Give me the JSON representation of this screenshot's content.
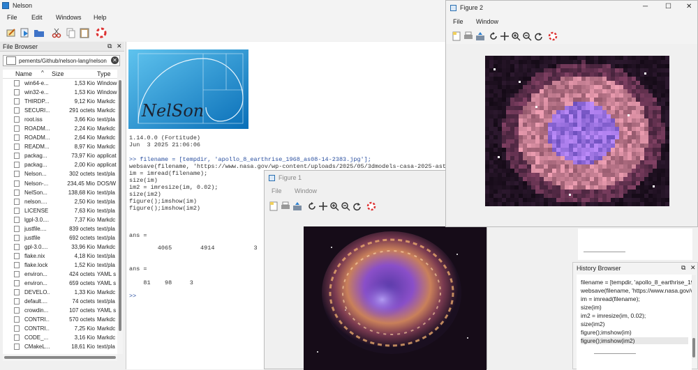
{
  "app": {
    "title": "Nelson"
  },
  "menus": [
    "File",
    "Edit",
    "Windows",
    "Help"
  ],
  "file_browser": {
    "header": "File Browser",
    "path": "pements/Github/nelson-lang/nelson",
    "columns": {
      "name": "Name",
      "size": "Size",
      "type": "Type"
    },
    "rows": [
      {
        "name": "win64-e...",
        "size": "1,53 Kio",
        "type": "Window"
      },
      {
        "name": "win32-e...",
        "size": "1,53 Kio",
        "type": "Window"
      },
      {
        "name": "THIRDP...",
        "size": "9,12 Kio",
        "type": "Markdc"
      },
      {
        "name": "SECURI...",
        "size": "291 octets",
        "type": "Markdc"
      },
      {
        "name": "root.iss",
        "size": "3,66 Kio",
        "type": "text/pla"
      },
      {
        "name": "ROADM...",
        "size": "2,24 Kio",
        "type": "Markdc"
      },
      {
        "name": "ROADM...",
        "size": "2,64 Kio",
        "type": "Markdc"
      },
      {
        "name": "READM...",
        "size": "8,97 Kio",
        "type": "Markdc"
      },
      {
        "name": "packag...",
        "size": "73,97 Kio",
        "type": "applicat"
      },
      {
        "name": "packag...",
        "size": "2,00 Kio",
        "type": "applicat"
      },
      {
        "name": "Nelson...",
        "size": "302 octets",
        "type": "text/pla"
      },
      {
        "name": "Nelson-...",
        "size": "234,45 Mio",
        "type": "DOS/W"
      },
      {
        "name": "NelSon...",
        "size": "138,68 Kio",
        "type": "text/pla"
      },
      {
        "name": "nelson....",
        "size": "2,50 Kio",
        "type": "text/pla"
      },
      {
        "name": "LICENSE",
        "size": "7,63 Kio",
        "type": "text/pla"
      },
      {
        "name": "lgpl-3.0....",
        "size": "7,37 Kio",
        "type": "Markdc"
      },
      {
        "name": "justfile....",
        "size": "839 octets",
        "type": "text/pla"
      },
      {
        "name": "justfile",
        "size": "692 octets",
        "type": "text/pla"
      },
      {
        "name": "gpl-3.0....",
        "size": "33,96 Kio",
        "type": "Markdc"
      },
      {
        "name": "flake.nix",
        "size": "4,18 Kio",
        "type": "text/pla"
      },
      {
        "name": "flake.lock",
        "size": "1,52 Kio",
        "type": "text/pla"
      },
      {
        "name": "environ...",
        "size": "424 octets",
        "type": "YAML s"
      },
      {
        "name": "environ...",
        "size": "659 octets",
        "type": "YAML s"
      },
      {
        "name": "DEVELO...",
        "size": "1,33 Kio",
        "type": "Markdc"
      },
      {
        "name": "default....",
        "size": "74 octets",
        "type": "text/pla"
      },
      {
        "name": "crowdin...",
        "size": "107 octets",
        "type": "YAML s"
      },
      {
        "name": "CONTRI...",
        "size": "570 octets",
        "type": "Markdc"
      },
      {
        "name": "CONTRI...",
        "size": "7,25 Kio",
        "type": "Markdc"
      },
      {
        "name": "CODE_...",
        "size": "3,16 Kio",
        "type": "Markdc"
      },
      {
        "name": "CMakeL...",
        "size": "18,61 Kio",
        "type": "text/pla"
      }
    ]
  },
  "console": {
    "version": "1.14.0.0 (Fortitude)",
    "date": "Jun  3 2025 21:06:06",
    "commands": [
      ">> filename = [tempdir, 'apollo_8_earthrise_1968_as08-14-2383.jpg'];",
      "websave(filename, 'https://www.nasa.gov/wp-content/uploads/2025/05/3dmodels-casa-2025-ast",
      "im = imread(filename);",
      "size(im)",
      "im2 = imresize(im, 0.02);",
      "size(im2)",
      "figure();imshow(im)",
      "figure();imshow(im2)"
    ],
    "ans1_label": "ans =",
    "ans1_values": "        4065        4914           3",
    "ans2_label": "ans =",
    "ans2_values": "    81    98     3",
    "prompt": ">>"
  },
  "logo_text": "NelSon",
  "figure1": {
    "title": "Figure 1",
    "menus": [
      "File",
      "Window"
    ]
  },
  "figure2": {
    "title": "Figure 2",
    "menus": [
      "File",
      "Window"
    ]
  },
  "history": {
    "header": "History Browser",
    "lines": [
      "filename = [tempdir, 'apollo_8_earthrise_1968",
      "websave(filename, 'https://www.nasa.gov/wp",
      "im = imread(filename);",
      "size(im)",
      "im2 = imresize(im, 0.02);",
      "size(im2)",
      "figure();imshow(im)",
      "figure();imshow(im2)"
    ]
  }
}
